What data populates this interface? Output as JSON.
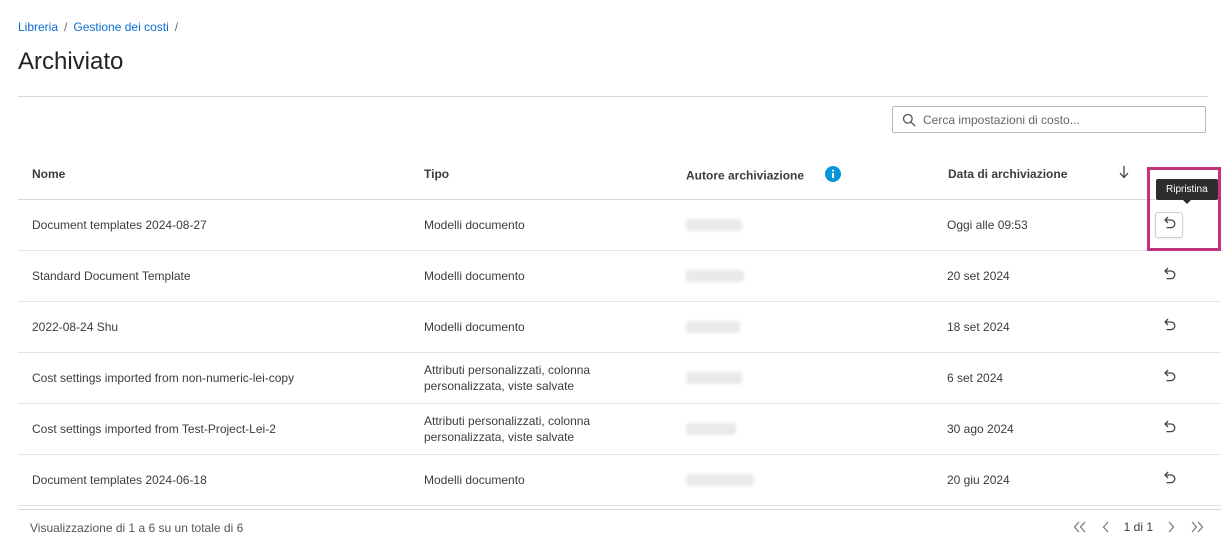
{
  "breadcrumb": {
    "items": [
      "Libreria",
      "Gestione dei costi"
    ],
    "separator": "/"
  },
  "page": {
    "title": "Archiviato"
  },
  "search": {
    "placeholder": "Cerca impostazioni di costo..."
  },
  "table": {
    "columns": {
      "name": "Nome",
      "type": "Tipo",
      "author": "Autore archiviazione",
      "date": "Data di archiviazione"
    },
    "sort": "descending",
    "rows": [
      {
        "name": "Document templates 2024-08-27",
        "type": "Modelli documento",
        "type2": "",
        "date": "Oggi alle 09:53"
      },
      {
        "name": "Standard Document Template",
        "type": "Modelli documento",
        "type2": "",
        "date": "20 set 2024"
      },
      {
        "name": "2022-08-24 Shu",
        "type": "Modelli documento",
        "type2": "",
        "date": "18 set 2024"
      },
      {
        "name": "Cost settings imported from non-numeric-lei-copy",
        "type": "Attributi personalizzati, colonna",
        "type2": "personalizzata, viste salvate",
        "date": "6 set 2024"
      },
      {
        "name": "Cost settings imported from Test-Project-Lei-2",
        "type": "Attributi personalizzati, colonna",
        "type2": "personalizzata, viste salvate",
        "date": "30 ago 2024"
      },
      {
        "name": "Document templates 2024-06-18",
        "type": "Modelli documento",
        "type2": "",
        "date": "20 giu 2024"
      }
    ]
  },
  "tooltip": {
    "text": "Ripristina"
  },
  "footer": {
    "summary": "Visualizzazione di 1 a 6 su un totale di 6",
    "page_label": "1 di 1"
  },
  "colors": {
    "link": "#0a6ed1",
    "info": "#0696d7",
    "highlight": "#c2337a"
  },
  "icons": [
    "search-icon",
    "info-icon",
    "sort-down-icon",
    "restore-icon",
    "first-page-icon",
    "prev-page-icon",
    "next-page-icon",
    "last-page-icon"
  ]
}
